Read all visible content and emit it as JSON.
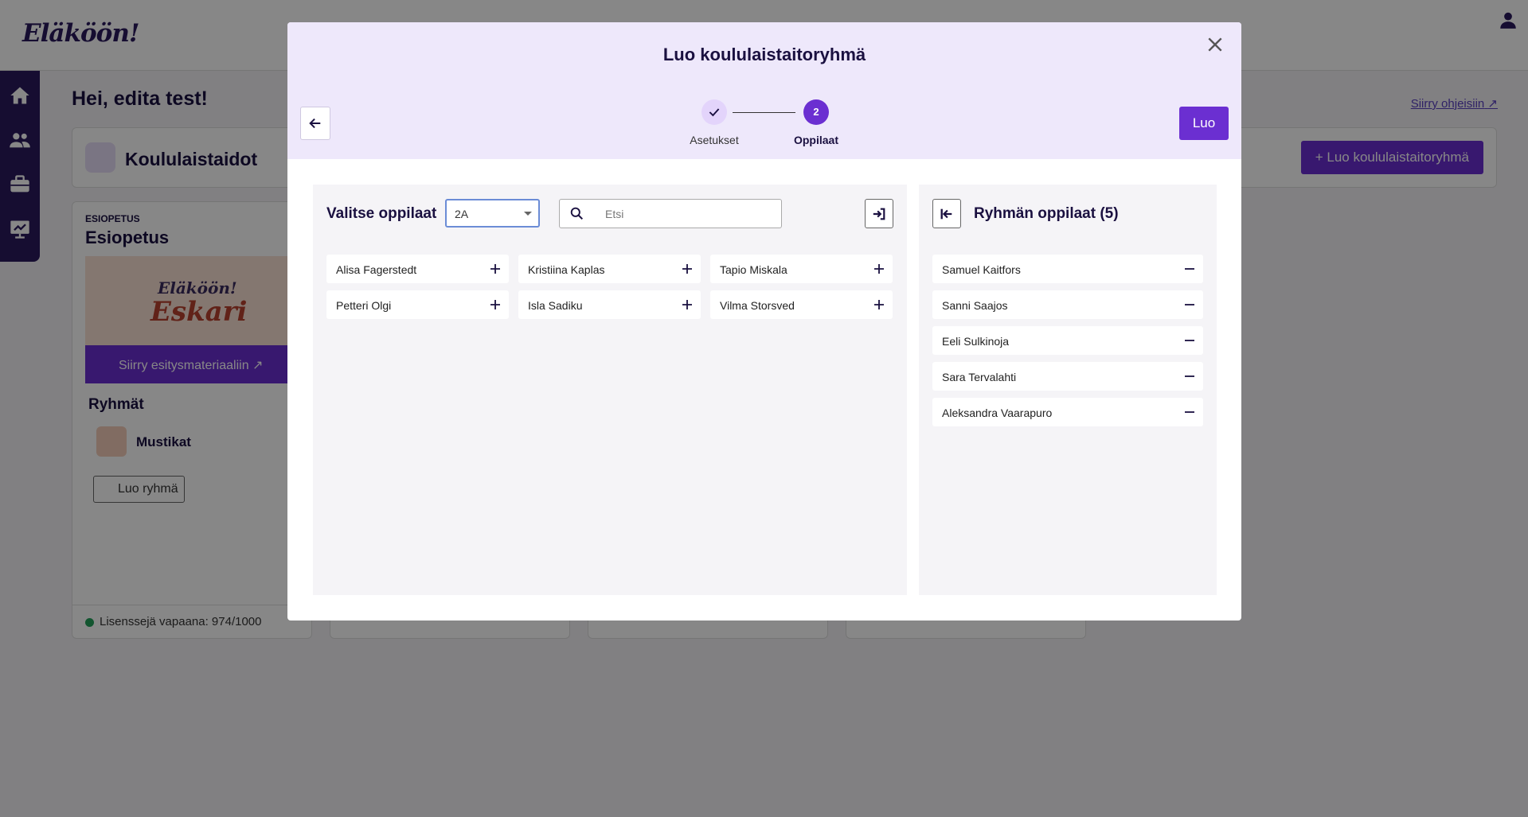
{
  "app": {
    "logo": "Eläköön!",
    "greeting": "Hei, edita test!",
    "help_link": "Siirry ohjeisiin",
    "product_title": "Koululaistaidot",
    "create_group_button": "Luo koululaistaitoryhmä"
  },
  "card": {
    "small_label": "ESIOPETUS",
    "title": "Esiopetus",
    "banner_top": "Eläköön!",
    "banner_bottom": "Eskari",
    "material_link": "Siirry esitysmateriaaliin",
    "groups_title": "Ryhmät",
    "group_name": "Mustikat",
    "new_group_button": "Luo ryhmä",
    "license_text": "Lisenssejä vapaana: 974/1000"
  },
  "modal": {
    "title": "Luo koululaistaitoryhmä",
    "create_button": "Luo",
    "steps": [
      {
        "label": "Asetukset",
        "status": "done"
      },
      {
        "label": "Oppilaat",
        "number": "2",
        "status": "current"
      }
    ],
    "left_panel": {
      "title": "Valitse oppilaat",
      "class_select_value": "2A",
      "search_placeholder": "Etsi"
    },
    "available_students": [
      "Alisa Fagerstedt",
      "Kristiina Kaplas",
      "Tapio Miskala",
      "Petteri Olgi",
      "Isla Sadiku",
      "Vilma Storsved"
    ],
    "right_panel": {
      "title": "Ryhmän oppilaat (5)"
    },
    "group_students": [
      "Samuel Kaitfors",
      "Sanni Saajos",
      "Eeli Sulkinoja",
      "Sara Tervalahti",
      "Aleksandra Vaarapuro"
    ]
  },
  "colors": {
    "primary": "#6b2fd1",
    "header_tint": "#eee8fb",
    "navy": "#1a1040"
  }
}
